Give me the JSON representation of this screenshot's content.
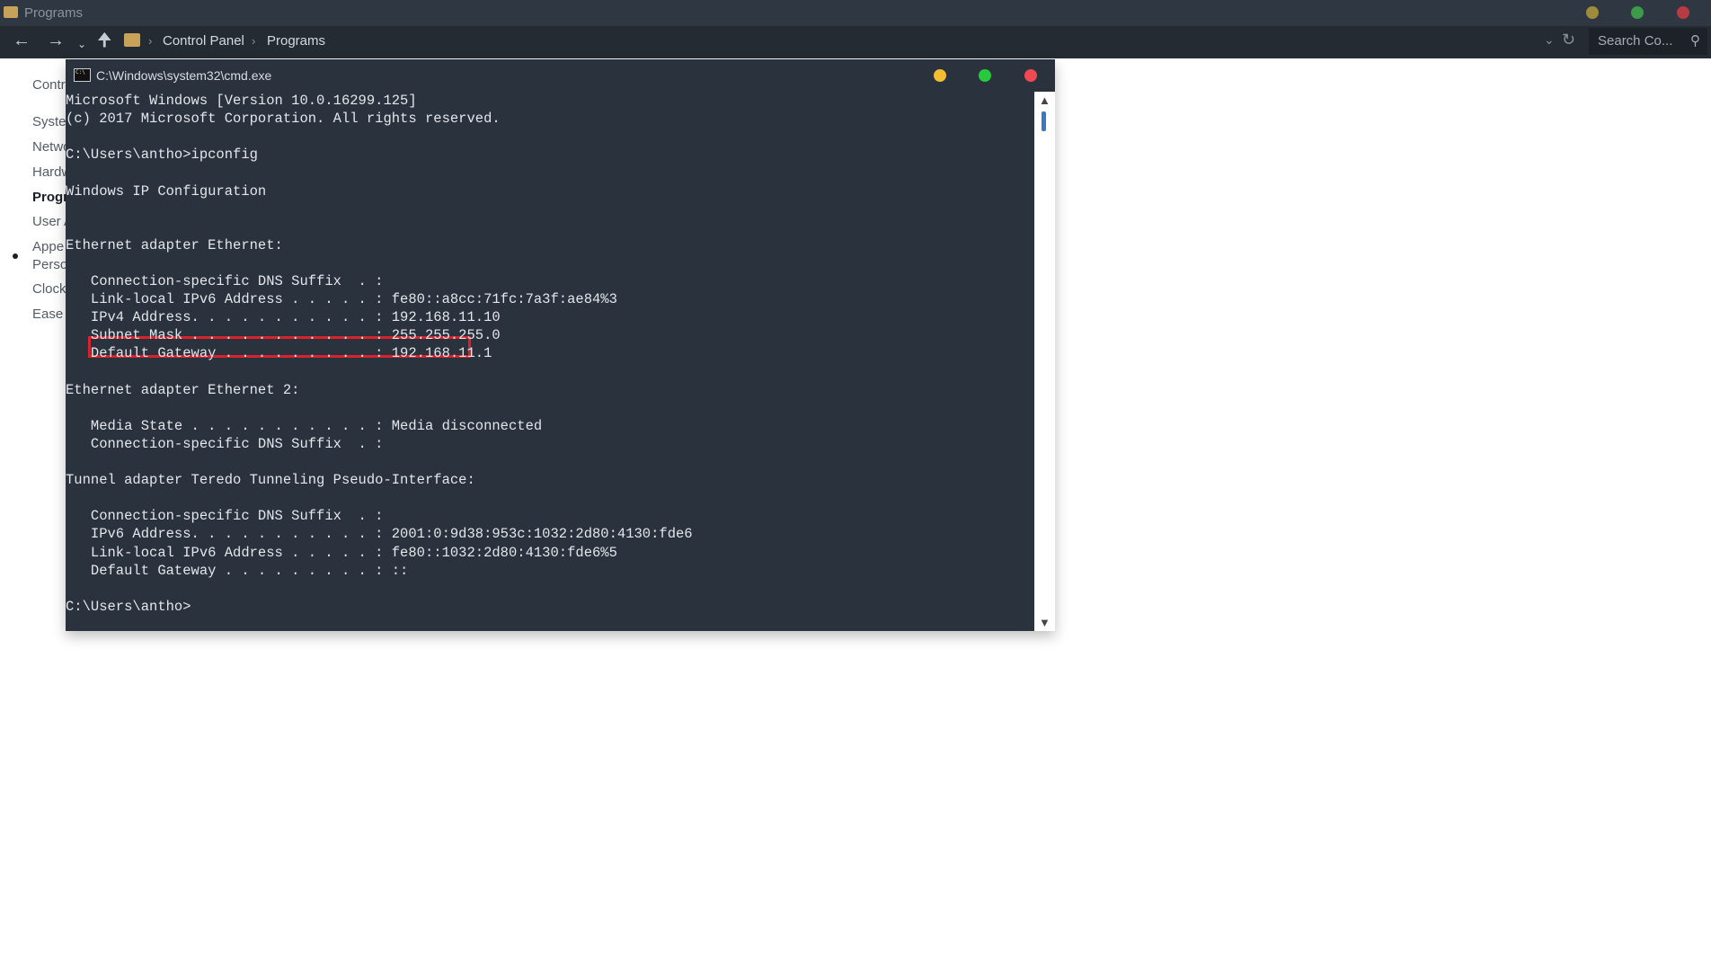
{
  "explorer": {
    "title": "Programs",
    "breadcrumb": [
      "Control Panel",
      "Programs"
    ],
    "search_placeholder": "Search Co...",
    "sidebar": [
      {
        "label": "Contr",
        "active": false
      },
      {
        "label": "Syste",
        "active": false
      },
      {
        "label": "Netwo",
        "active": false
      },
      {
        "label": "Hardw",
        "active": false
      },
      {
        "label": "Progr",
        "active": true
      },
      {
        "label": "User A",
        "active": false
      },
      {
        "label": "Appe",
        "active": false
      },
      {
        "label": "Perso",
        "active": false
      },
      {
        "label": "Clock",
        "active": false
      },
      {
        "label": "Ease c",
        "active": false
      }
    ],
    "window_dot_colors": [
      "#a08a3c",
      "#3c9a49",
      "#b83a42"
    ]
  },
  "cmd": {
    "title": "C:\\Windows\\system32\\cmd.exe",
    "dot_colors": [
      "#f2be2f",
      "#27c93f",
      "#ef4a51"
    ],
    "lines": [
      "Microsoft Windows [Version 10.0.16299.125]",
      "(c) 2017 Microsoft Corporation. All rights reserved.",
      "",
      "C:\\Users\\antho>ipconfig",
      "",
      "Windows IP Configuration",
      "",
      "",
      "Ethernet adapter Ethernet:",
      "",
      "   Connection-specific DNS Suffix  . :",
      "   Link-local IPv6 Address . . . . . : fe80::a8cc:71fc:7a3f:ae84%3",
      "   IPv4 Address. . . . . . . . . . . : 192.168.11.10",
      "   Subnet Mask . . . . . . . . . . . : 255.255.255.0",
      "   Default Gateway . . . . . . . . . : 192.168.11.1",
      "",
      "Ethernet adapter Ethernet 2:",
      "",
      "   Media State . . . . . . . . . . . : Media disconnected",
      "   Connection-specific DNS Suffix  . :",
      "",
      "Tunnel adapter Teredo Tunneling Pseudo-Interface:",
      "",
      "   Connection-specific DNS Suffix  . :",
      "   IPv6 Address. . . . . . . . . . . : 2001:0:9d38:953c:1032:2d80:4130:fde6",
      "   Link-local IPv6 Address . . . . . : fe80::1032:2d80:4130:fde6%5",
      "   Default Gateway . . . . . . . . . : ::",
      "",
      "C:\\Users\\antho>"
    ],
    "highlight_color": "#d8232d"
  }
}
